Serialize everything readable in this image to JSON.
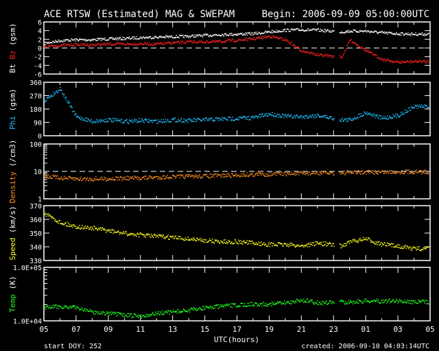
{
  "chart_data": {
    "type": "scatter",
    "title": "ACE RTSW (Estimated) MAG & SWEPAM",
    "begin": "Begin: 2006-09-09 05:00:00UTC",
    "xlabel": "UTC(hours)",
    "x_ticks": [
      "05",
      "07",
      "09",
      "11",
      "13",
      "15",
      "17",
      "19",
      "21",
      "23",
      "01",
      "03",
      "05"
    ],
    "x_range_hours": [
      0,
      24
    ],
    "gap_hours": [
      18.0,
      18.35
    ],
    "footer_left": "start DOY: 252",
    "footer_right": "created: 2006-09-10 04:03:14UTC",
    "hours": [
      0,
      1,
      2,
      3,
      4,
      5,
      6,
      7,
      8,
      9,
      10,
      11,
      12,
      13,
      14,
      15,
      16,
      17,
      18.5,
      19,
      20,
      21,
      22,
      23
    ],
    "panels": [
      {
        "ylabel_parts": [
          {
            "t": "Bt ",
            "c": "#ffffff"
          },
          {
            "t": "Bz",
            "c": "#ff2020"
          },
          {
            "t": " (gsm)",
            "c": "#ffffff"
          }
        ],
        "scale": "linear",
        "ylim": [
          -6,
          6
        ],
        "ticks": [
          "6",
          "4",
          "2",
          "0",
          "-2",
          "-4",
          "-6"
        ],
        "tick_values": [
          6,
          4,
          2,
          0,
          -2,
          -4,
          -6
        ],
        "dashed": 0,
        "series": [
          {
            "name": "Bt",
            "color": "#ffffff",
            "values": [
              1.2,
              1.8,
              2.0,
              2.0,
              2.2,
              2.3,
              2.5,
              2.6,
              2.7,
              2.8,
              3.0,
              3.2,
              3.3,
              3.4,
              3.8,
              4.2,
              4.3,
              4.2,
              3.8,
              4.0,
              4.0,
              3.6,
              3.4,
              3.3
            ]
          },
          {
            "name": "Bz",
            "color": "#ff2020",
            "values": [
              0.4,
              0.7,
              0.9,
              0.8,
              1.0,
              1.0,
              1.1,
              1.0,
              1.3,
              1.5,
              1.5,
              1.6,
              1.9,
              2.2,
              2.8,
              2.0,
              -0.5,
              -1.5,
              -2.0,
              2.0,
              -0.5,
              -2.5,
              -3.2,
              -3.0
            ]
          }
        ]
      },
      {
        "ylabel_parts": [
          {
            "t": "Phi",
            "c": "#20c0ff"
          },
          {
            "t": " (gsm)",
            "c": "#ffffff"
          }
        ],
        "scale": "linear",
        "ylim": [
          0,
          360
        ],
        "ticks": [
          "360",
          "270",
          "180",
          "90",
          "0"
        ],
        "tick_values": [
          360,
          270,
          180,
          90,
          0
        ],
        "series": [
          {
            "name": "Phi",
            "color": "#20c0ff",
            "values": [
              240,
              320,
              130,
              100,
              110,
              100,
              105,
              100,
              110,
              105,
              110,
              115,
              120,
              125,
              150,
              135,
              130,
              140,
              110,
              110,
              160,
              120,
              140,
              200
            ]
          }
        ]
      },
      {
        "ylabel_parts": [
          {
            "t": "Density",
            "c": "#ff9020"
          },
          {
            "t": " (/cm3)",
            "c": "#ffffff"
          }
        ],
        "scale": "log",
        "ylim": [
          1,
          100
        ],
        "ticks": [
          "100",
          "10",
          "1"
        ],
        "tick_values": [
          100,
          10,
          1
        ],
        "dashed": 10,
        "series": [
          {
            "name": "Density",
            "color": "#ff9020",
            "values": [
              7,
              6,
              5.5,
              5.5,
              5.6,
              5.8,
              6,
              6.3,
              6.6,
              6.8,
              7,
              7.3,
              7.6,
              8,
              8.2,
              8.5,
              8.7,
              9,
              9.2,
              9.4,
              9.6,
              9.8,
              10,
              10
            ]
          }
        ]
      },
      {
        "ylabel_parts": [
          {
            "t": "Speed",
            "c": "#ffff20"
          },
          {
            "t": " (km/s)",
            "c": "#ffffff"
          }
        ],
        "scale": "linear",
        "ylim": [
          330,
          370
        ],
        "ticks": [
          "370",
          "360",
          "350",
          "340",
          "330"
        ],
        "tick_values": [
          370,
          360,
          350,
          340,
          330
        ],
        "series": [
          {
            "name": "Speed",
            "color": "#ffff20",
            "values": [
              365,
              358,
              355,
              354,
              352,
              350,
              349,
              348,
              347,
              346,
              345,
              344,
              344,
              343,
              342,
              342,
              341,
              343,
              341,
              344,
              346,
              342,
              341,
              339
            ]
          }
        ]
      },
      {
        "ylabel_parts": [
          {
            "t": "Temp",
            "c": "#20ff20"
          },
          {
            "t": " (K)",
            "c": "#ffffff"
          }
        ],
        "scale": "log",
        "ylim": [
          10000,
          100000
        ],
        "ticks": [
          "1.0E+05",
          "1.0E+04"
        ],
        "tick_values": [
          100000,
          10000
        ],
        "series": [
          {
            "name": "Temp",
            "color": "#20ff20",
            "values": [
              18000,
              19000,
              18000,
              15000,
              14000,
              13000,
              12500,
              14000,
              15000,
              16000,
              18000,
              19000,
              20000,
              21000,
              21000,
              22000,
              25000,
              22000,
              23000,
              23000,
              24000,
              24000,
              24000,
              23000
            ]
          }
        ]
      }
    ]
  }
}
